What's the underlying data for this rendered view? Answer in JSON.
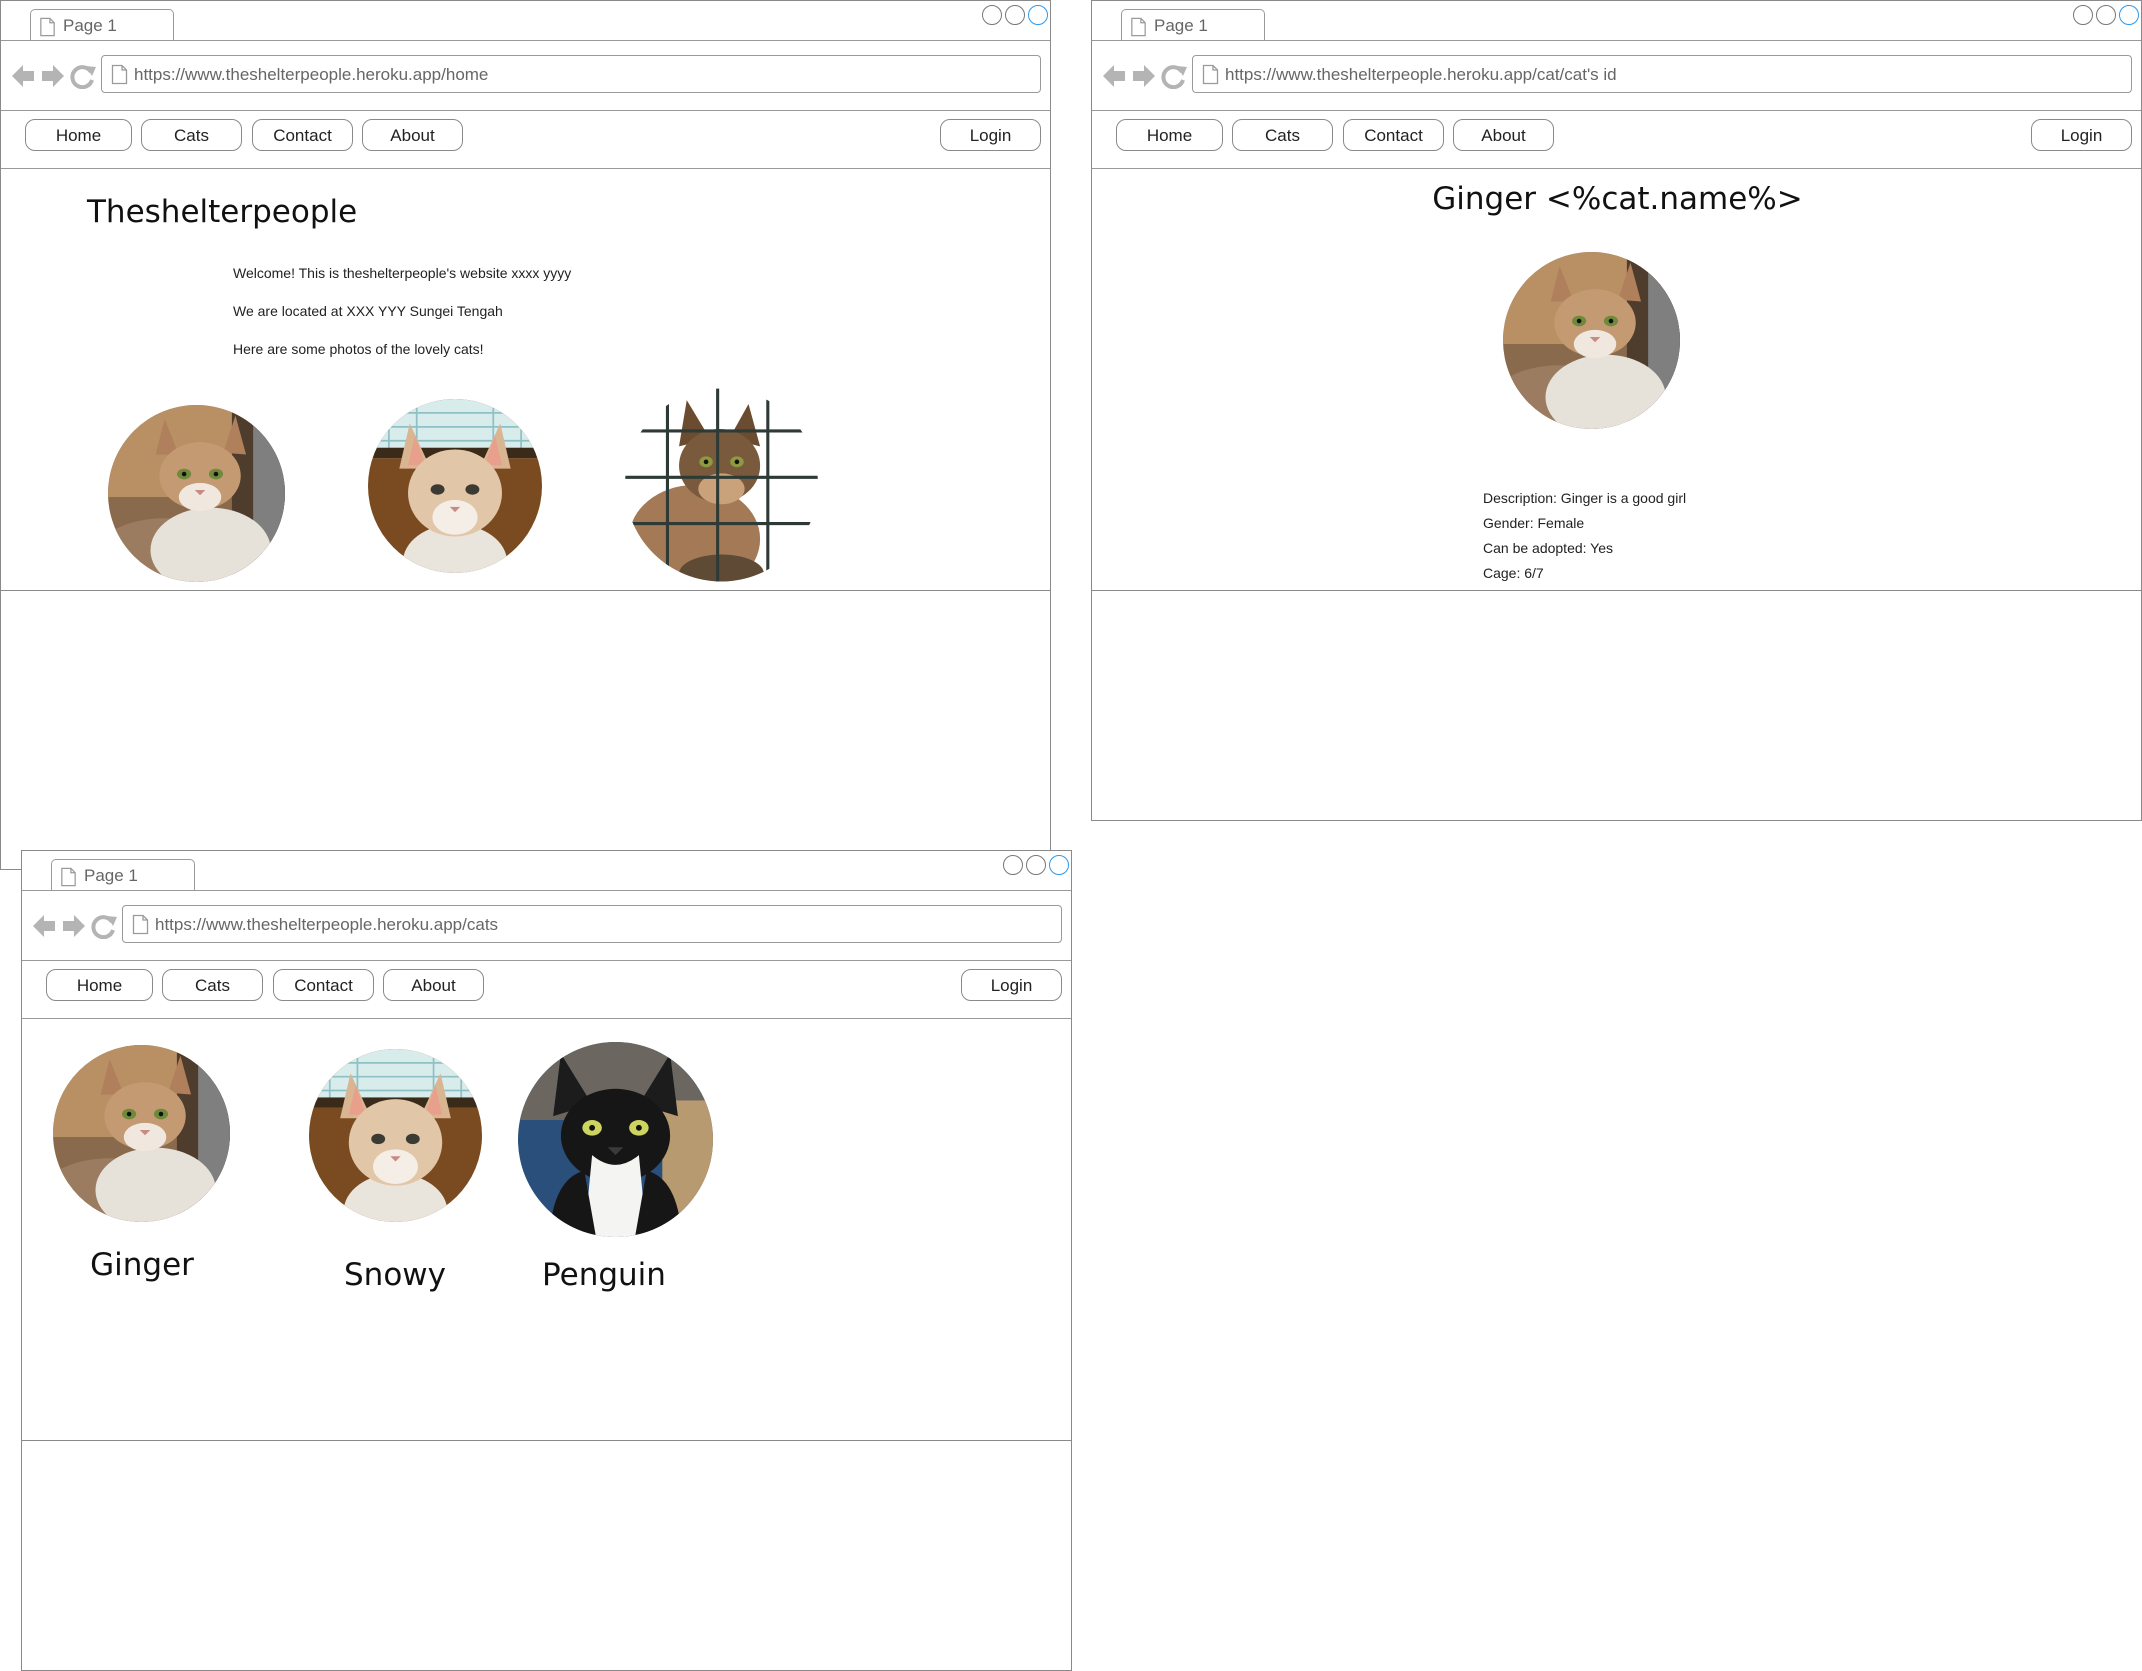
{
  "browser": {
    "tab_label": "Page 1",
    "nav": {
      "home": "Home",
      "cats": "Cats",
      "contact": "Contact",
      "about": "About",
      "login": "Login"
    }
  },
  "home_window": {
    "url": "https://www.theshelterpeople.heroku.app/home",
    "title": "Theshelterpeople",
    "paragraphs": [
      "Welcome! This is theshelterpeople's website xxxx yyyy",
      "We are located at XXX YYY Sungei Tengah",
      "Here are some photos of the lovely cats!"
    ],
    "photos": [
      "ginger",
      "snowy",
      "tabby-in-cage"
    ]
  },
  "cat_window": {
    "url": "https://www.theshelterpeople.heroku.app/cat/cat's id",
    "title": "Ginger <%cat.name%>",
    "photo": "ginger",
    "details": [
      "Description: Ginger is a good girl",
      "Gender: Female",
      "Can be adopted: Yes",
      "Cage: 6/7"
    ]
  },
  "cats_window": {
    "url": "https://www.theshelterpeople.heroku.app/cats",
    "cats": [
      {
        "name": "Ginger",
        "photo": "ginger"
      },
      {
        "name": "Snowy",
        "photo": "snowy"
      },
      {
        "name": "Penguin",
        "photo": "penguin"
      }
    ]
  },
  "icons": [
    "page-icon",
    "back-arrow-icon",
    "forward-arrow-icon",
    "reload-icon"
  ],
  "colors": {
    "frame": "#8a8a8a",
    "window_button_active": "#2c9bea"
  }
}
